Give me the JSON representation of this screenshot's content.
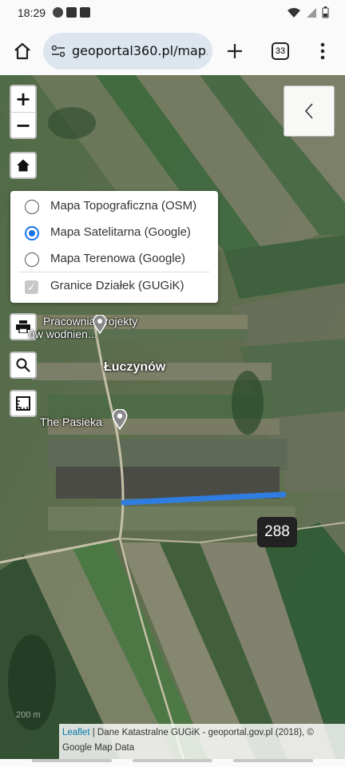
{
  "status_bar": {
    "time": "18:29",
    "left_icons": [
      "notification-icon",
      "check-icon",
      "image-icon"
    ],
    "right_icons": [
      "wifi-icon",
      "signal-icon",
      "battery-icon"
    ]
  },
  "browser": {
    "url": "geoportal360.pl/map.",
    "tab_count": "33",
    "icons": [
      "home-icon",
      "site-settings-icon",
      "new-tab-icon",
      "tabs-icon",
      "menu-icon"
    ]
  },
  "map": {
    "zoom_in_label": "+",
    "zoom_out_label": "−",
    "layers": [
      {
        "label": "Mapa Topograficzna (OSM)",
        "selected": false
      },
      {
        "label": "Mapa Satelitarna (Google)",
        "selected": true
      },
      {
        "label": "Mapa Terenowa (Google)",
        "selected": false
      }
    ],
    "overlay": {
      "label": "Granice Działek (GUGiK)",
      "checked": true
    },
    "places": [
      {
        "label": "Łuczynów"
      },
      {
        "label": "The Pasieka"
      },
      {
        "label": "Pracownia projekty"
      },
      {
        "label": "ów wodnien..."
      }
    ],
    "parcel_number": "288",
    "scale_label": "200 m",
    "attribution": {
      "leaflet": "Leaflet",
      "text": " | Dane Katastralne GUGiK - geoportal.gov.pl (2018), © Google Map Data"
    }
  },
  "colors": {
    "selection": "#2f7de1",
    "badge": "#222222",
    "radio_active": "#1a73e8"
  }
}
